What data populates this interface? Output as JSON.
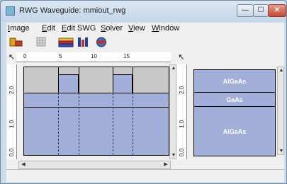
{
  "window": {
    "title": "RWG Waveguide: mmiout_rwg"
  },
  "controls": {
    "minimize": "—",
    "maximize": "☐",
    "close": "✕"
  },
  "menu": [
    {
      "label": "Image"
    },
    {
      "label": "Edit"
    },
    {
      "label": "Edit SWG"
    },
    {
      "label": "Solver"
    },
    {
      "label": "View"
    },
    {
      "label": "Window"
    }
  ],
  "toolbar": [
    {
      "icon": "waveguide-open-icon"
    },
    {
      "icon": "grid-icon"
    },
    {
      "icon": "layer-stack-icon"
    },
    {
      "icon": "mode-solver-icon"
    },
    {
      "icon": "globe-icon"
    }
  ],
  "ruler": {
    "x_ticks": [
      "0",
      "5",
      "10",
      "15"
    ],
    "y_ticks": [
      "2.0",
      "1.0",
      "0.0"
    ]
  },
  "layers": [
    {
      "label": "AlGaAs"
    },
    {
      "label": "GaAs"
    },
    {
      "label": "AlGaAs"
    }
  ],
  "layer_ruler": {
    "y_ticks": [
      "2.0",
      "1.0",
      "0.0"
    ]
  }
}
